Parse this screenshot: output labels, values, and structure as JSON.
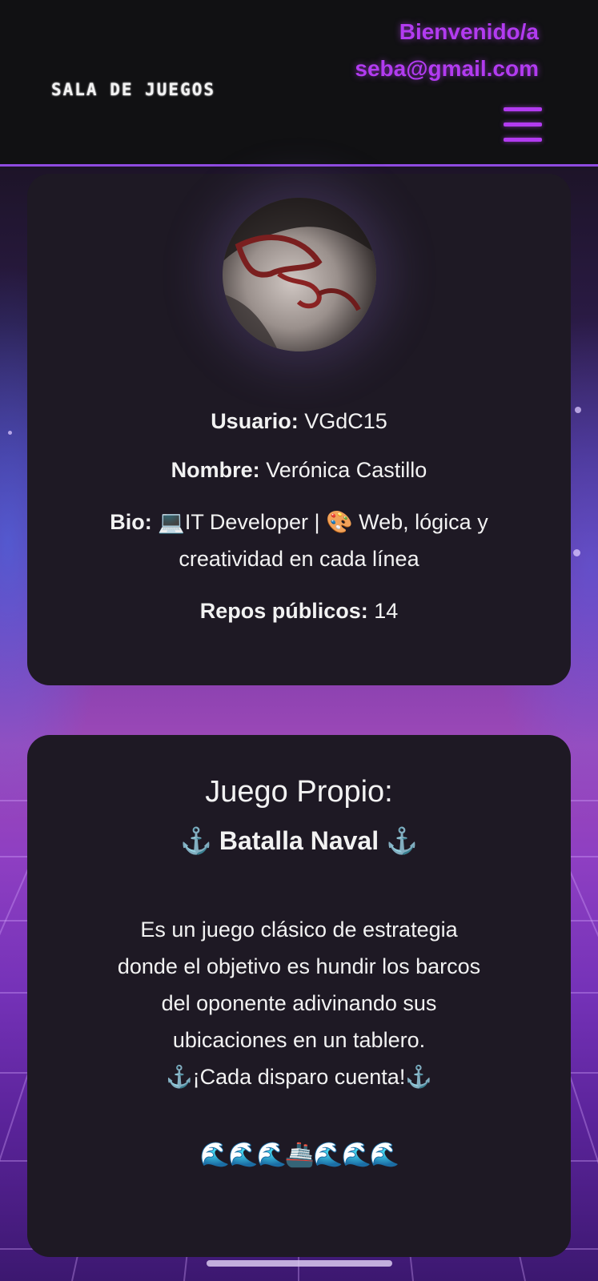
{
  "header": {
    "brand": "SALA DE JUEGOS",
    "welcome": "Bienvenido/a",
    "email": "seba@gmail.com",
    "menu_icon": "hamburger-menu-icon",
    "accent_color": "#b23bf0"
  },
  "profile": {
    "avatar_alt": "profile photo",
    "usuario_label": "Usuario:",
    "usuario_value": "VGdC15",
    "nombre_label": "Nombre:",
    "nombre_value": "Verónica Castillo",
    "bio_label": "Bio:",
    "bio_value": "💻IT Developer | 🎨 Web, lógica y creatividad en cada línea",
    "repos_label": "Repos públicos:",
    "repos_value": "14"
  },
  "game": {
    "title": "Juego Propio:",
    "subtitle": "⚓ Batalla Naval ⚓",
    "description": "Es un juego clásico de estrategia donde el objetivo es hundir los barcos del oponente adivinando sus ubicaciones en un tablero.",
    "tagline": "⚓¡Cada disparo cuenta!⚓",
    "waves": "🌊🌊🌊🚢🌊🌊🌊"
  }
}
